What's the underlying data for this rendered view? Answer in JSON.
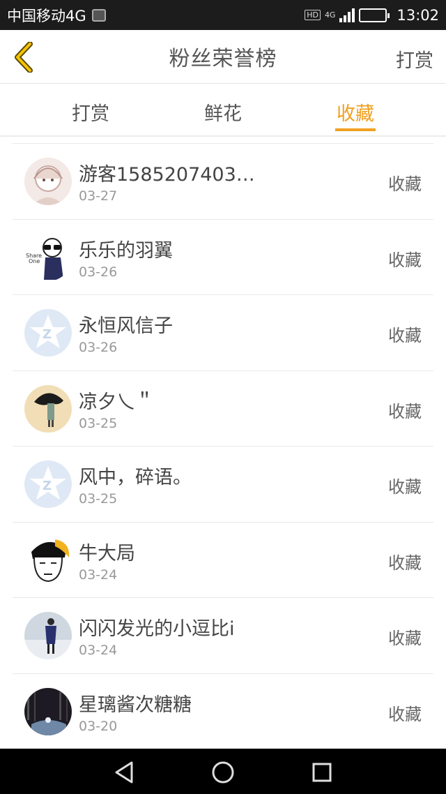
{
  "status_bar": {
    "carrier": "中国移动4G",
    "hd": "HD",
    "network": "4G",
    "battery_level": 0.9,
    "time": "13:02"
  },
  "header": {
    "title": "粉丝荣誉榜",
    "right_action": "打赏",
    "back_icon": "chevron-left-icon"
  },
  "tabs": [
    {
      "label": "打赏",
      "active": false
    },
    {
      "label": "鲜花",
      "active": false
    },
    {
      "label": "收藏",
      "active": true
    }
  ],
  "colors": {
    "accent": "#f0a020",
    "status_bar": "#1c1c1c",
    "nav_bar": "#000000"
  },
  "fans": [
    {
      "name": "游客1585207403…",
      "date": "03-27",
      "action": "收藏",
      "avatar": "anime-girl-avatar"
    },
    {
      "name": "乐乐的羽翼",
      "date": "03-26",
      "action": "收藏",
      "avatar": "cartoon-sunglasses-avatar"
    },
    {
      "name": "永恒风信子",
      "date": "03-26",
      "action": "收藏",
      "avatar": "default-qq-avatar"
    },
    {
      "name": "凉夕乀＂",
      "date": "03-25",
      "action": "收藏",
      "avatar": "umbrella-figure-avatar"
    },
    {
      "name": "风中，碎语。",
      "date": "03-25",
      "action": "收藏",
      "avatar": "default-qq-avatar"
    },
    {
      "name": "牛大局",
      "date": "03-24",
      "action": "收藏",
      "avatar": "cartoon-face-avatar"
    },
    {
      "name": "闪闪发光的小逗比i",
      "date": "03-24",
      "action": "收藏",
      "avatar": "photo-person-avatar"
    },
    {
      "name": "星璃酱次糖糖",
      "date": "03-20",
      "action": "收藏",
      "avatar": "dark-photo-avatar"
    }
  ]
}
